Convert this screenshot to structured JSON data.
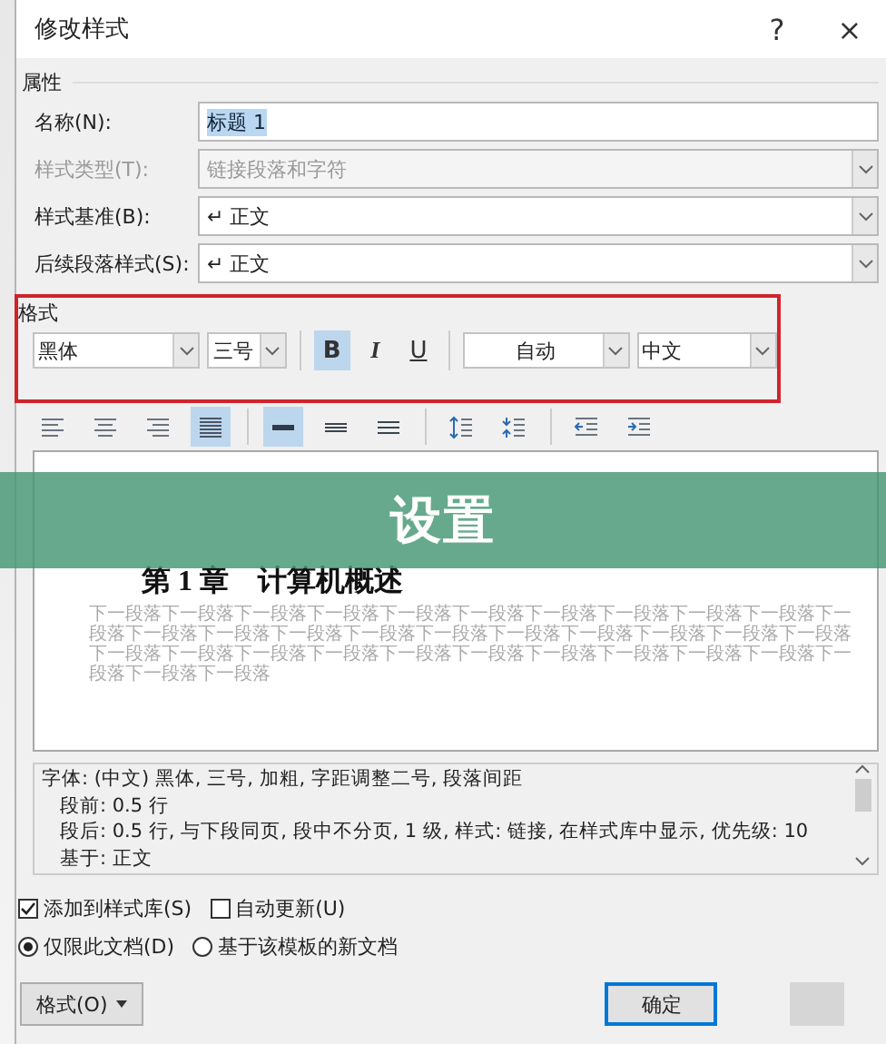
{
  "window": {
    "title": "修改样式",
    "help": "?",
    "close": "×"
  },
  "properties": {
    "heading": "属性",
    "fields": [
      {
        "label": "名称(N):",
        "kind": "text",
        "value": "标题 1",
        "selected": true,
        "disabled": false
      },
      {
        "label": "样式类型(T):",
        "kind": "combo",
        "value": "链接段落和字符",
        "disabled": true
      },
      {
        "label": "样式基准(B):",
        "kind": "combo",
        "value": "↵ 正文",
        "disabled": false
      },
      {
        "label": "后续段落样式(S):",
        "kind": "combo",
        "value": "↵ 正文",
        "disabled": false
      }
    ]
  },
  "format": {
    "heading": "格式",
    "font": "黑体",
    "size": "三号",
    "styles": [
      {
        "kind": "bold",
        "label": "B",
        "selected": true
      },
      {
        "kind": "italic",
        "label": "I",
        "selected": false
      },
      {
        "kind": "underline",
        "label": "U",
        "selected": false
      }
    ],
    "font_color": "自动",
    "script": "中文"
  },
  "paragraph_tools": [
    {
      "kind": "align-left",
      "selected": false
    },
    {
      "kind": "align-center",
      "selected": false
    },
    {
      "kind": "align-right",
      "selected": false
    },
    {
      "kind": "justify",
      "selected": true
    },
    {
      "kind": "single-spacing",
      "selected": true
    },
    {
      "kind": "one-half-spacing",
      "selected": false
    },
    {
      "kind": "double-spacing",
      "selected": false
    },
    {
      "kind": "space-before",
      "selected": false
    },
    {
      "kind": "space-after",
      "selected": false
    },
    {
      "kind": "decrease-indent",
      "selected": false
    },
    {
      "kind": "increase-indent",
      "selected": false
    }
  ],
  "preview": {
    "heading": "第 1 章　计算机概述",
    "following": "下一段落下一段落下一段落下一段落下一段落下一段落下一段落下一段落下一段落下一段落下一段落下一段落下一段落下一段落下一段落下一段落下一段落下一段落下一段落下一段落下一段落下一段落下一段落下一段落下一段落下一段落下一段落下一段落下一段落下一段落下一段落下一段落下一段落下一段落"
  },
  "description": [
    "字体: (中文) 黑体, 三号, 加粗, 字距调整二号, 段落间距",
    "段前: 0.5 行",
    "段后: 0.5 行, 与下段同页, 段中不分页, 1 级, 样式: 链接, 在样式库中显示, 优先级: 10",
    "基于: 正文"
  ],
  "checkboxes": [
    {
      "label": "添加到样式库(S)",
      "checked": true
    },
    {
      "label": "自动更新(U)",
      "checked": false
    }
  ],
  "radios": [
    {
      "label": "仅限此文档(D)",
      "selected": true
    },
    {
      "label": "基于该模板的新文档",
      "selected": false
    }
  ],
  "buttons": {
    "format_menu": "格式(O)",
    "ok": "确定"
  },
  "banner": {
    "title": "设置"
  }
}
